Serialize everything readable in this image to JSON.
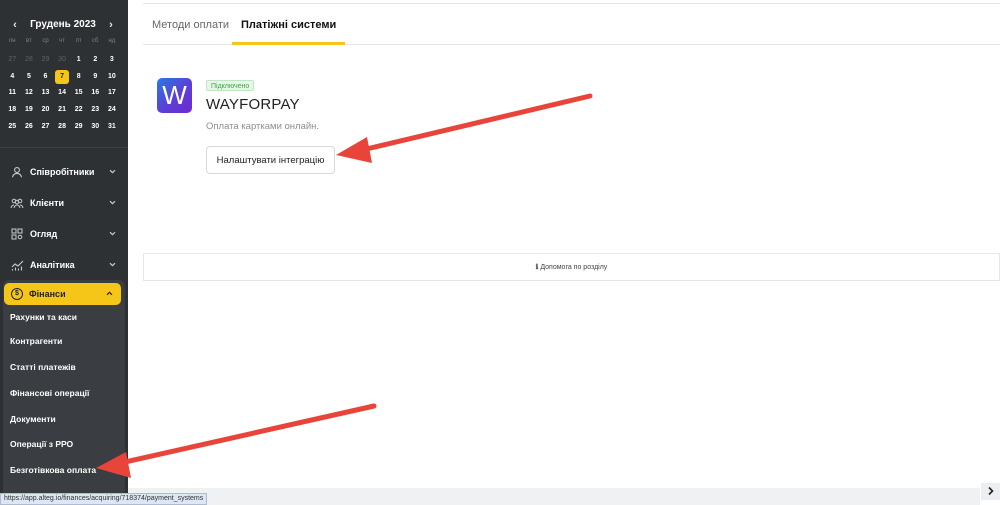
{
  "calendar": {
    "title": "Грудень 2023",
    "prev": "‹",
    "next": "›",
    "weekdays": [
      "пн",
      "вт",
      "ср",
      "чт",
      "пт",
      "сб",
      "нд"
    ],
    "days": [
      [
        "27",
        "28",
        "29",
        "30",
        "1",
        "2",
        "3"
      ],
      [
        "4",
        "5",
        "6",
        "7",
        "8",
        "9",
        "10"
      ],
      [
        "11",
        "12",
        "13",
        "14",
        "15",
        "16",
        "17"
      ],
      [
        "18",
        "19",
        "20",
        "21",
        "22",
        "23",
        "24"
      ],
      [
        "25",
        "26",
        "27",
        "28",
        "29",
        "30",
        "31"
      ]
    ],
    "dim_prefix_count": 4,
    "today": "7"
  },
  "menu": {
    "items": [
      {
        "label": "Співробітники",
        "icon": "user-icon"
      },
      {
        "label": "Клієнти",
        "icon": "clients-icon"
      },
      {
        "label": "Огляд",
        "icon": "overview-icon"
      },
      {
        "label": "Аналітика",
        "icon": "analytics-icon"
      }
    ],
    "finance": {
      "label": "Фінанси",
      "icon": "dollar-icon"
    },
    "finance_sub": [
      "Рахунки та каси",
      "Контрагенти",
      "Статті платежів",
      "Фінансові операції",
      "Документи",
      "Операції з РРО",
      "Безготівкова оплата"
    ]
  },
  "tabs": [
    "Методи оплати",
    "Платіжні системи"
  ],
  "provider": {
    "logo_letter": "W",
    "status": "Підключено",
    "name": "WAYFORPAY",
    "description": "Оплата картками онлайн.",
    "button": "Налаштувати інтеграцію"
  },
  "help": "Допомога по розділу",
  "status_url": "https://app.alteg.io/finances/acquiring/718374/payment_systems",
  "colors": {
    "accent": "#f5c518",
    "sidebar": "#2e3134",
    "arrow": "#e8443a",
    "success": "#3aa64a"
  }
}
